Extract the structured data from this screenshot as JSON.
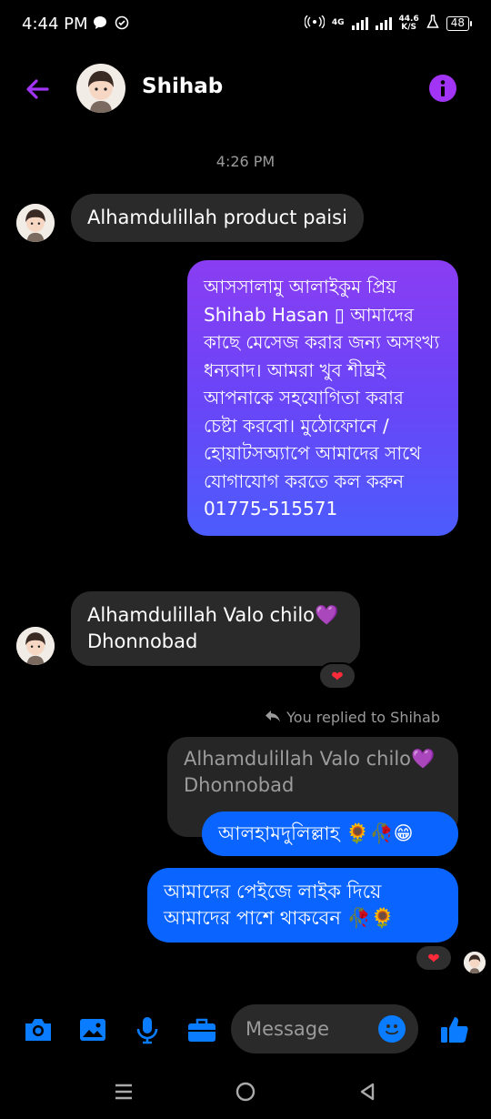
{
  "status": {
    "time": "4:44 PM",
    "network": "4G",
    "speed_value": "44.6",
    "speed_unit": "K/S",
    "battery": "48"
  },
  "header": {
    "contact_name": "Shihab"
  },
  "conversation": {
    "timestamp": "4:26 PM",
    "messages": [
      {
        "side": "incoming",
        "text": "Alhamdulillah product paisi"
      },
      {
        "side": "outgoing",
        "text": "আসসালামু আলাইকুম প্রিয় Shihab Hasan ▯ আমাদের কাছে মেসেজ করার জন্য অসংখ্য ধন্যবাদ। আমরা খুব শীঘ্রই আপনাকে সহযোগিতা করার চেষ্টা করবো। মুঠোফোনে /হোয়াটসঅ্যাপে আমাদের সাথে যোগাযোগ করতে কল করুন 01775-515571"
      },
      {
        "side": "incoming",
        "text": "Alhamdulillah Valo chilo💜 Dhonnobad",
        "reaction": "❤"
      },
      {
        "side": "outgoing",
        "reply_label": "You replied to Shihab",
        "quoted": "Alhamdulillah Valo chilo💜 Dhonnobad",
        "text": "আলহামদুলিল্লাহ 🌻🥀😁"
      },
      {
        "side": "outgoing",
        "text": "আমাদের পেইজে লাইক দিয়ে আমাদের পাশে থাকবেন 🥀🌻",
        "reaction": "❤"
      }
    ]
  },
  "composer": {
    "placeholder": "Message"
  },
  "colors": {
    "accent": "#a235f5",
    "bubble_blue": "#0a64ff",
    "bubble_incoming": "#2a2a2a",
    "icon_blue": "#0a7cff"
  }
}
